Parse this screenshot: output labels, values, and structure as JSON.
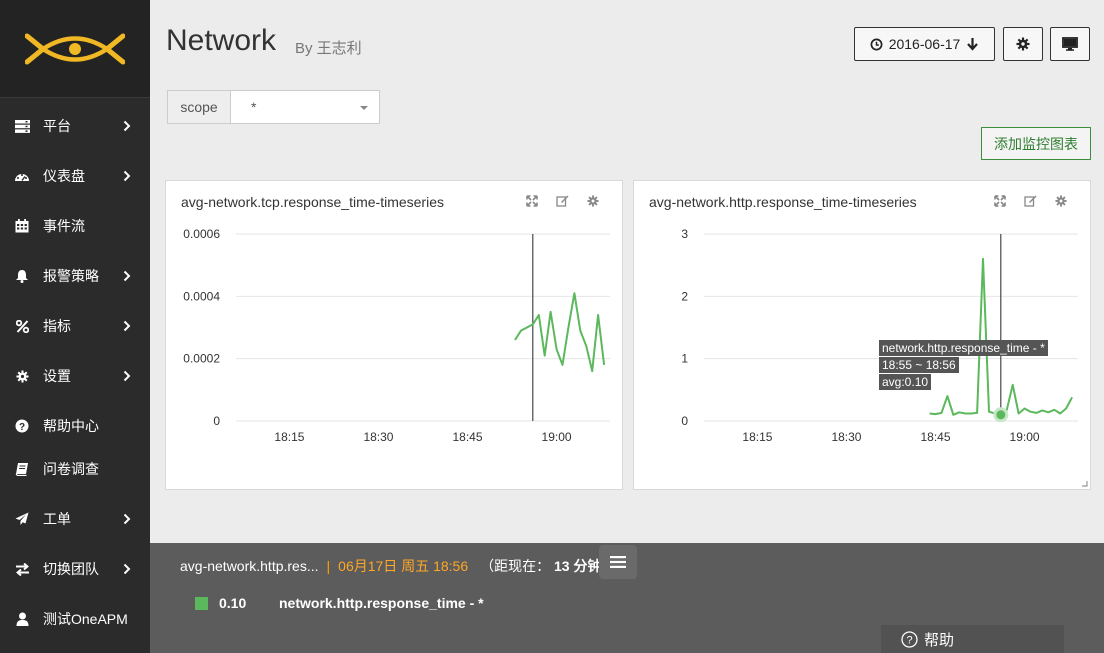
{
  "sidebar": {
    "items": [
      {
        "label": "平台",
        "icon": "server-icon",
        "has_arrow": true
      },
      {
        "label": "仪表盘",
        "icon": "dashboard-icon",
        "has_arrow": true
      },
      {
        "label": "事件流",
        "icon": "calendar-icon",
        "has_arrow": false
      },
      {
        "label": "报警策略",
        "icon": "bell-icon",
        "has_arrow": true
      },
      {
        "label": "指标",
        "icon": "percent-icon",
        "has_arrow": true
      },
      {
        "label": "设置",
        "icon": "gear-icon",
        "has_arrow": true
      },
      {
        "label": "帮助中心",
        "icon": "question-circle-icon",
        "has_arrow": false
      },
      {
        "label": "问卷调查",
        "icon": "book-icon",
        "has_arrow": false
      },
      {
        "label": "工单",
        "icon": "paper-plane-icon",
        "has_arrow": true
      },
      {
        "label": "切换团队",
        "icon": "exchange-icon",
        "has_arrow": true
      },
      {
        "label": "测试OneAPM",
        "icon": "user-icon",
        "has_arrow": false
      }
    ]
  },
  "header": {
    "title": "Network",
    "byline": "By 王志利",
    "date": "2016-06-17"
  },
  "scope": {
    "label": "scope",
    "value": "*"
  },
  "add_chart_label": "添加监控图表",
  "panels": [
    {
      "title": "avg-network.tcp.response_time-timeseries",
      "chart_data": {
        "type": "line",
        "y_ticks": [
          "0.0006",
          "0.0004",
          "0.0002",
          "0"
        ],
        "x_ticks": [
          "18:15",
          "18:30",
          "18:45",
          "19:00"
        ],
        "ylim": [
          0,
          0.0006
        ],
        "series": [
          {
            "x": [
              "18:53",
              "18:54",
              "18:55",
              "18:56",
              "18:57",
              "18:58",
              "18:59",
              "19:00",
              "19:01",
              "19:02",
              "19:03",
              "19:04",
              "19:05",
              "19:06",
              "19:07",
              "19:08"
            ],
            "values": [
              0.00026,
              0.00029,
              0.0003,
              0.00031,
              0.00034,
              0.00021,
              0.00035,
              0.00023,
              0.00018,
              0.0003,
              0.00041,
              0.00029,
              0.00024,
              0.00016,
              0.00034,
              0.00018
            ],
            "color": "#5cb85c"
          }
        ],
        "crosshair_x": "18:56"
      }
    },
    {
      "title": "avg-network.http.response_time-timeseries",
      "chart_data": {
        "type": "line",
        "y_ticks": [
          "3",
          "2",
          "1",
          "0"
        ],
        "x_ticks": [
          "18:15",
          "18:30",
          "18:45",
          "19:00"
        ],
        "ylim": [
          0,
          3
        ],
        "series": [
          {
            "name": "network.http.response_time - *",
            "x": [
              "18:44",
              "18:45",
              "18:46",
              "18:47",
              "18:48",
              "18:49",
              "18:50",
              "18:51",
              "18:52",
              "18:53",
              "18:54",
              "18:55",
              "18:56",
              "18:57",
              "18:58",
              "18:59",
              "19:00",
              "19:01",
              "19:02",
              "19:03",
              "19:04",
              "19:05",
              "19:06",
              "19:07",
              "19:08"
            ],
            "values": [
              0.12,
              0.11,
              0.13,
              0.4,
              0.1,
              0.14,
              0.12,
              0.12,
              0.13,
              2.6,
              0.15,
              0.12,
              0.1,
              0.18,
              0.58,
              0.12,
              0.2,
              0.15,
              0.13,
              0.17,
              0.14,
              0.18,
              0.12,
              0.2,
              0.38
            ],
            "color": "#5cb85c"
          }
        ],
        "crosshair_x": "18:56",
        "highlight_x": "18:56"
      },
      "tooltip": {
        "series": "network.http.response_time - *",
        "range": "18:55 ~ 18:56",
        "value": "avg:0.10"
      }
    }
  ],
  "bottom": {
    "chart_name": "avg-network.http.res...",
    "separator": "|",
    "time": "06月17日 周五 18:56",
    "relative_prefix": "（距现在：",
    "relative_value": "13 分钟前",
    "relative_suffix": "）",
    "legend_value": "0.10",
    "legend_name": "network.http.response_time - *",
    "help_label": "帮助"
  }
}
